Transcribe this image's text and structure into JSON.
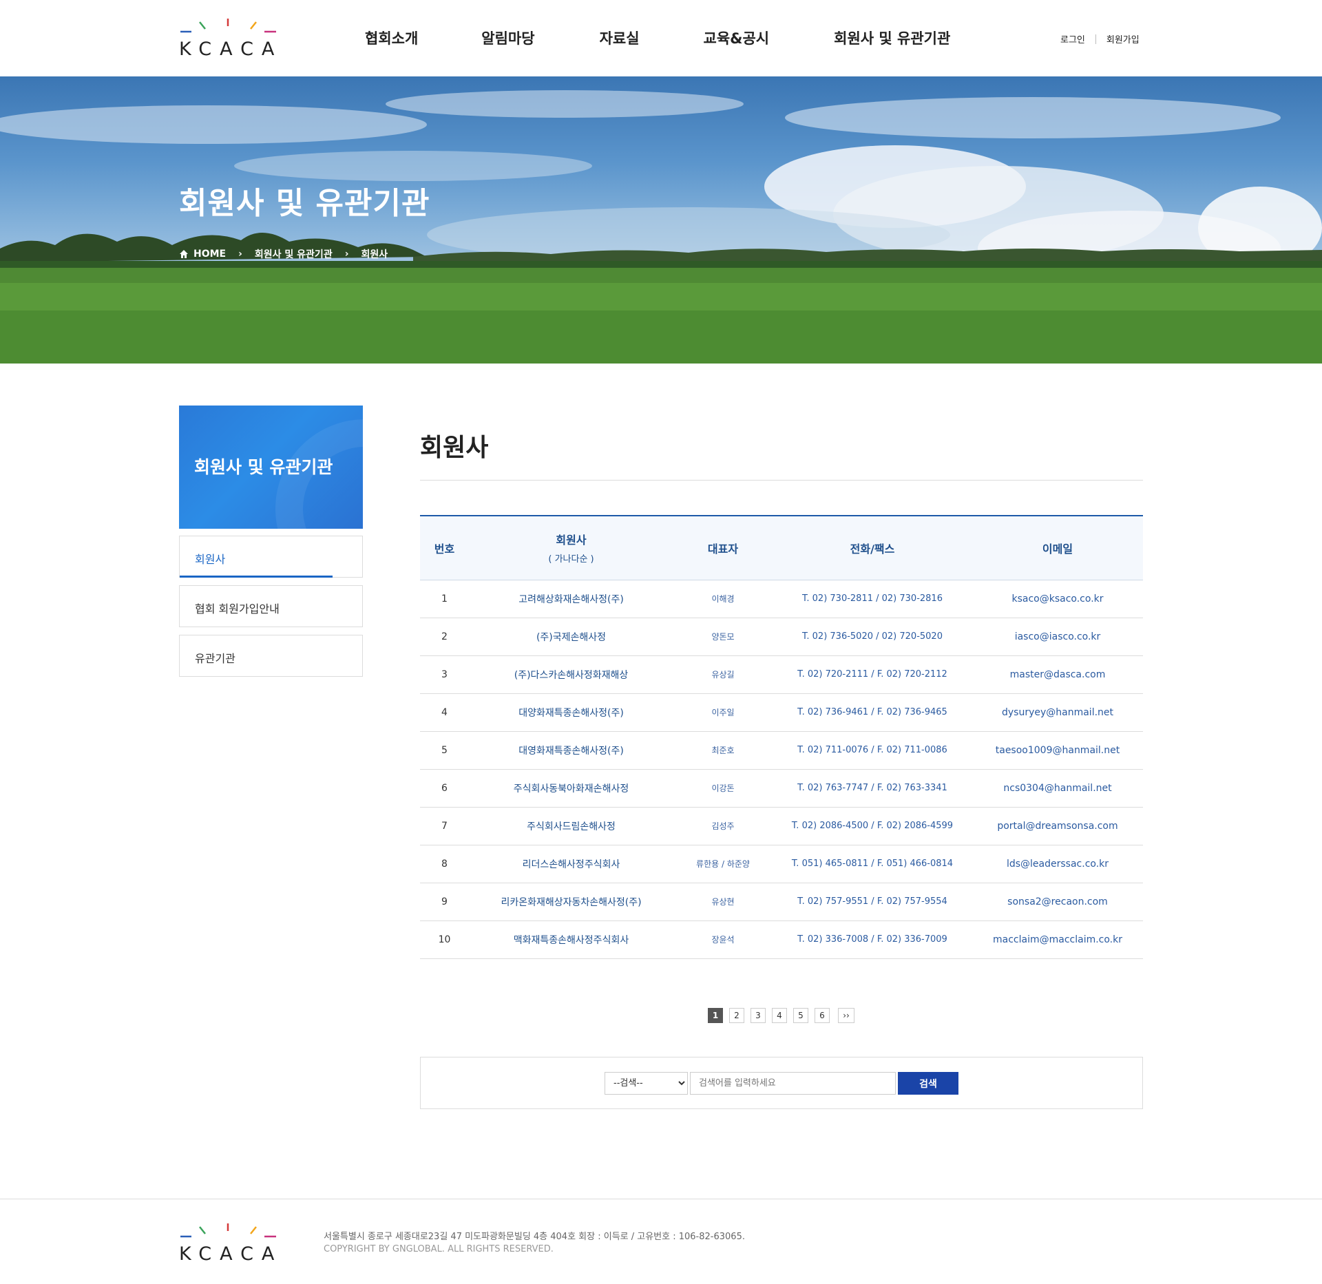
{
  "header": {
    "logo_text": "KCACA",
    "menu": [
      "협회소개",
      "알림마당",
      "자료실",
      "교육&공시",
      "회원사 및 유관기관"
    ],
    "login": "로그인",
    "join": "회원가입"
  },
  "visual": {
    "title": "회원사 및 유관기관",
    "breadcrumb": [
      "HOME",
      "회원사 및 유관기관",
      "회원사"
    ]
  },
  "sidebar": {
    "title": "회원사 및 유관기관",
    "items": [
      "회원사",
      "협회 회원가입안내",
      "유관기관"
    ]
  },
  "main": {
    "title": "회원사",
    "table": {
      "headers": [
        "번호",
        "회원사",
        "대표자",
        "전화/팩스",
        "이메일"
      ],
      "header_sub": "( 가나다순 )",
      "rows": [
        [
          "1",
          "고려해상화재손해사정(주)",
          "이해경",
          "T. 02) 730-2811 / 02) 730-2816",
          "ksaco@ksaco.co.kr"
        ],
        [
          "2",
          "(주)국제손해사정",
          "양돈모",
          "T. 02) 736-5020 / 02) 720-5020",
          "iasco@iasco.co.kr"
        ],
        [
          "3",
          "(주)다스카손해사정화재해상",
          "유상길",
          "T. 02) 720-2111 / F. 02) 720-2112",
          "master@dasca.com"
        ],
        [
          "4",
          "대양화재특종손해사정(주)",
          "이주일",
          "T. 02) 736-9461 / F. 02) 736-9465",
          "dysuryey@hanmail.net"
        ],
        [
          "5",
          "대영화재특종손해사정(주)",
          "최준호",
          "T. 02) 711-0076 / F. 02) 711-0086",
          "taesoo1009@hanmail.net"
        ],
        [
          "6",
          "주식회사동북아화재손해사정",
          "이강돈",
          "T. 02) 763-7747 / F. 02) 763-3341",
          "ncs0304@hanmail.net"
        ],
        [
          "7",
          "주식회사드림손해사정",
          "김성주",
          "T. 02) 2086-4500 / F. 02) 2086-4599",
          "portal@dreamsonsa.com"
        ],
        [
          "8",
          "리더스손해사정주식회사",
          "류한용 / 하준양",
          "T. 051) 465-0811 / F. 051) 466-0814",
          "lds@leaderssac.co.kr"
        ],
        [
          "9",
          "리카온화재해상자동차손해사정(주)",
          "유상현",
          "T. 02) 757-9551 / F. 02) 757-9554",
          "sonsa2@recaon.com"
        ],
        [
          "10",
          "맥화재특종손해사정주식회사",
          "장윤석",
          "T. 02) 336-7008 / F. 02) 336-7009",
          "macclaim@macclaim.co.kr"
        ]
      ]
    },
    "pagination": [
      "1",
      "2",
      "3",
      "4",
      "5",
      "6"
    ],
    "pagination_next": "››",
    "current_page": 1,
    "search": {
      "select_value": "--검색--",
      "placeholder": "검색어를 입력하세요",
      "button": "검색"
    }
  },
  "footer": {
    "logo_text": "KCACA",
    "address": "서울특별시 종로구 세종대로23길 47 미도파광화문빌딩 4층 404호  회장 : 이득로 / 고유번호 : 106-82-63065.",
    "copyright": "COPYRIGHT BY GNGLOBAL. ALL RIGHTS RESERVED."
  },
  "colors": {
    "accent": "#1a66c5",
    "table_header_text": "#1e4f8c",
    "search_button": "#1a44a8",
    "logo_marks": [
      "#2a5fb8",
      "#3aa35a",
      "#d43a3a",
      "#f2a51a",
      "#c8327d"
    ]
  }
}
